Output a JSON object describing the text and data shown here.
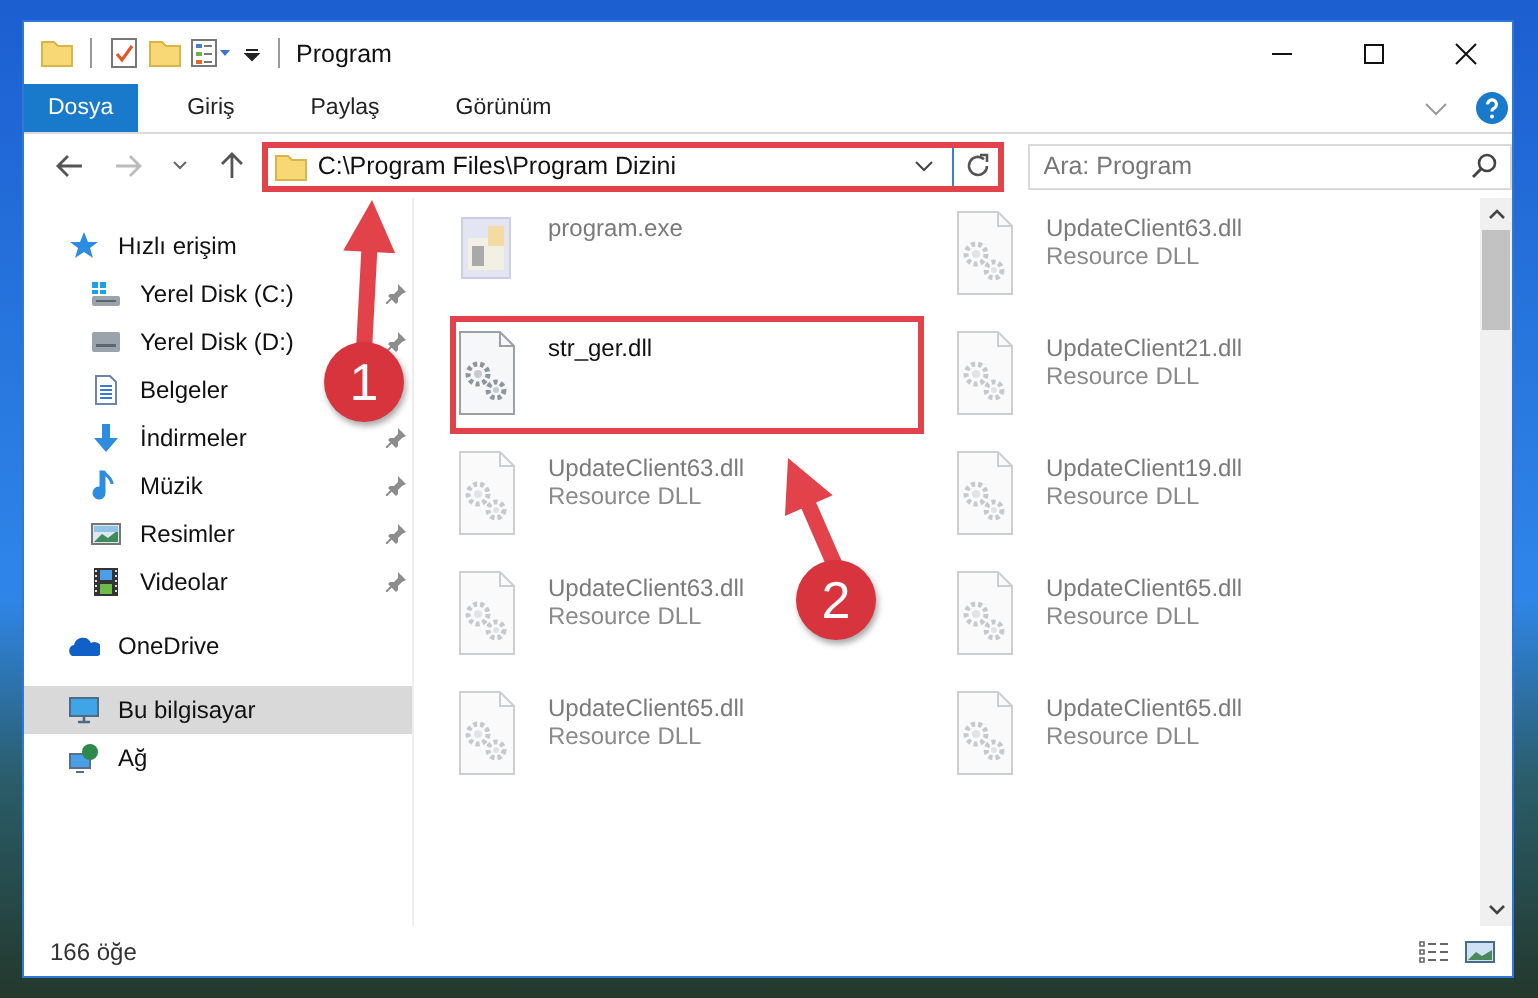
{
  "window": {
    "title": "Program"
  },
  "ribbon_tabs": [
    {
      "label": "Dosya",
      "selected": true
    },
    {
      "label": "Giriş",
      "selected": false
    },
    {
      "label": "Paylaş",
      "selected": false
    },
    {
      "label": "Görünüm",
      "selected": false
    }
  ],
  "address_bar": {
    "path": "C:\\Program Files\\Program Dizini",
    "highlighted": true
  },
  "search": {
    "placeholder": "Ara: Program"
  },
  "sidebar": {
    "items": [
      {
        "label": "Hızlı erişim",
        "kind": "star",
        "selected": false,
        "children": [
          {
            "label": "Yerel Disk (C:)",
            "kind": "drive-c",
            "pinned": true,
            "selected": false
          },
          {
            "label": "Yerel Disk (D:)",
            "kind": "drive",
            "pinned": true,
            "selected": false
          },
          {
            "label": "Belgeler",
            "kind": "documents",
            "pinned": false,
            "selected": false
          },
          {
            "label": "İndirmeler",
            "kind": "download",
            "pinned": true,
            "selected": false
          },
          {
            "label": "Müzik",
            "kind": "music",
            "pinned": true,
            "selected": false
          },
          {
            "label": "Resimler",
            "kind": "pictures",
            "pinned": true,
            "selected": false
          },
          {
            "label": "Videolar",
            "kind": "video",
            "pinned": true,
            "selected": false
          }
        ]
      },
      {
        "label": "OneDrive",
        "kind": "cloud",
        "selected": false
      },
      {
        "label": "Bu bilgisayar",
        "kind": "computer",
        "selected": true
      },
      {
        "label": "Ağ",
        "kind": "network",
        "selected": false
      }
    ]
  },
  "files": [
    {
      "name": "program.exe",
      "kind": "exe",
      "blurred": true,
      "highlighted": false
    },
    {
      "name": "UpdateClient63.dll",
      "type": "Resource DLL",
      "kind": "dll",
      "blurred": true,
      "highlighted": false
    },
    {
      "name": "str_ger.dll",
      "kind": "dll",
      "blurred": false,
      "highlighted": true
    },
    {
      "name": "UpdateClient21.dll",
      "type": "Resource DLL",
      "kind": "dll",
      "blurred": true,
      "highlighted": false
    },
    {
      "name": "UpdateClient63.dll",
      "type": "Resource DLL",
      "kind": "dll",
      "blurred": true,
      "highlighted": false
    },
    {
      "name": "UpdateClient19.dll",
      "type": "Resource DLL",
      "kind": "dll",
      "blurred": true,
      "highlighted": false
    },
    {
      "name": "UpdateClient63.dll",
      "type": "Resource DLL",
      "kind": "dll",
      "blurred": true,
      "highlighted": false
    },
    {
      "name": "UpdateClient65.dll",
      "type": "Resource DLL",
      "kind": "dll",
      "blurred": true,
      "highlighted": false
    },
    {
      "name": "UpdateClient65.dll",
      "type": "Resource DLL",
      "kind": "dll",
      "blurred": true,
      "highlighted": false
    },
    {
      "name": "UpdateClient65.dll",
      "type": "Resource DLL",
      "kind": "dll",
      "blurred": true,
      "highlighted": false
    }
  ],
  "status_bar": {
    "item_count": "166 öğe"
  },
  "annotations": [
    {
      "number": "1"
    },
    {
      "number": "2"
    }
  ]
}
